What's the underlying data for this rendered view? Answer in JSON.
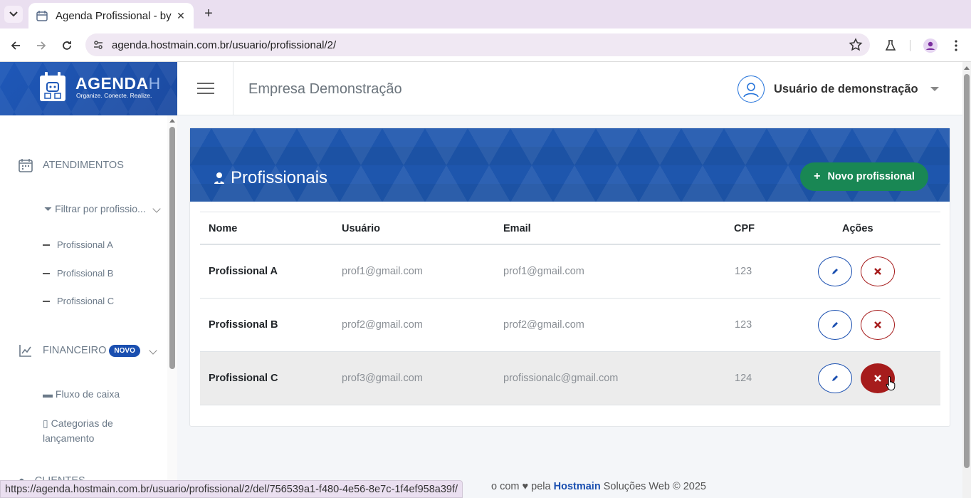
{
  "browser": {
    "tab_title": "Agenda Profissional - by Hostmain",
    "url": "agenda.hostmain.com.br/usuario/profissional/2/",
    "status_url": "https://agenda.hostmain.com.br/usuario/profissional/2/del/756539a1-f480-4e56-8e7c-1f4ef958a39f/"
  },
  "header": {
    "logo_main": "AGENDA",
    "logo_h": "H",
    "logo_tagline": "Organize. Conecte. Realize.",
    "company": "Empresa Demonstração",
    "user_name": "Usuário de demonstração"
  },
  "sidebar": {
    "atendimentos": "ATENDIMENTOS",
    "filter": "Filtrar por profissio...",
    "professionals": [
      "Profissional A",
      "Profissional B",
      "Profissional C"
    ],
    "financeiro": "FINANCEIRO",
    "new_badge": "NOVO",
    "fluxo": "Fluxo de caixa",
    "categorias": "Categorias de lançamento",
    "clientes": "CLIENTES"
  },
  "content": {
    "title": "Profissionais",
    "new_button": "Novo profissional",
    "columns": {
      "nome": "Nome",
      "usuario": "Usuário",
      "email": "Email",
      "cpf": "CPF",
      "acoes": "Ações"
    },
    "rows": [
      {
        "nome": "Profissional A",
        "usuario": "prof1@gmail.com",
        "email": "prof1@gmail.com",
        "cpf": "123"
      },
      {
        "nome": "Profissional B",
        "usuario": "prof2@gmail.com",
        "email": "prof2@gmail.com",
        "cpf": "123"
      },
      {
        "nome": "Profissional C",
        "usuario": "prof3@gmail.com",
        "email": "profissionalc@gmail.com",
        "cpf": "124"
      }
    ]
  },
  "footer": {
    "prefix": "o com",
    "by": "pela",
    "brand": "Hostmain",
    "suffix": "Soluções Web © 2025"
  },
  "colors": {
    "primary": "#1a4fb0",
    "success": "#198754",
    "danger": "#a61c1c"
  }
}
